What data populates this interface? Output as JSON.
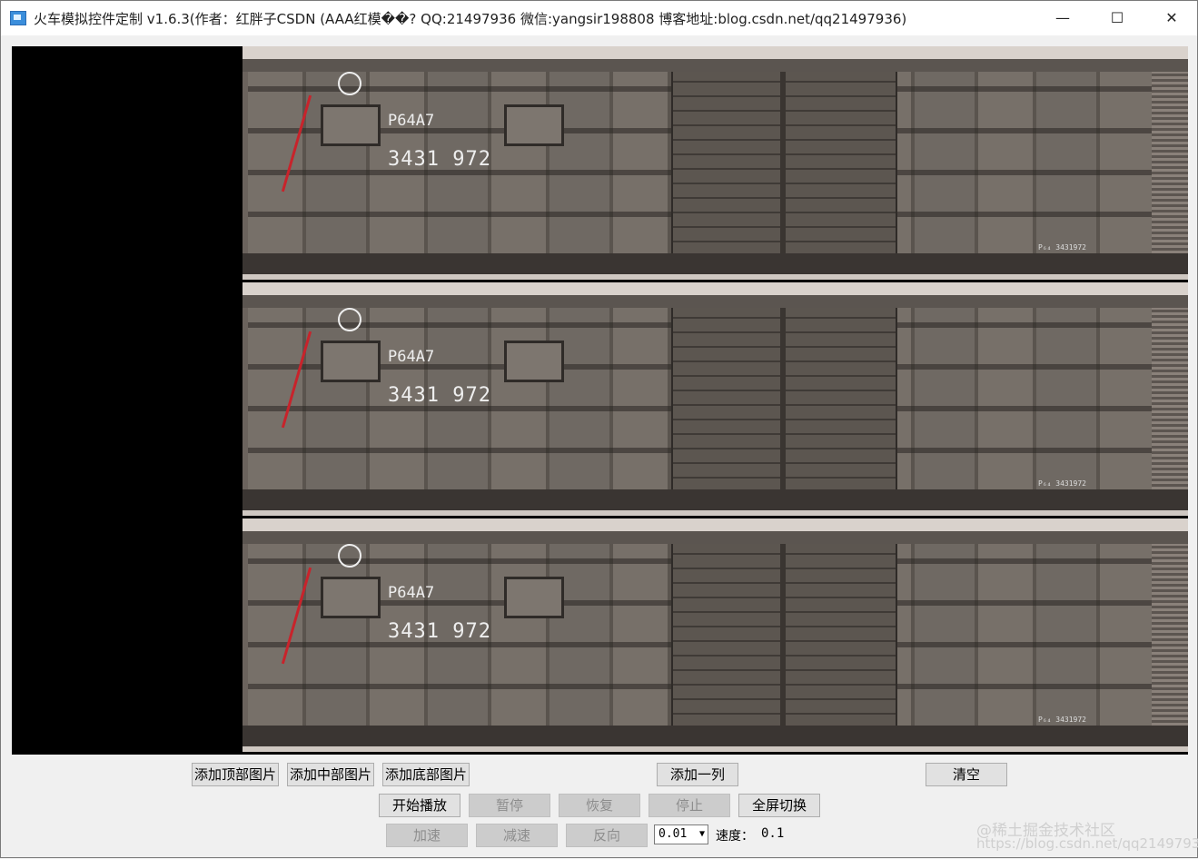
{
  "window": {
    "title": "火车模拟控件定制 v1.6.3(作者：红胖子CSDN (AAA红模��? QQ:21497936 微信:yangsir198808 博客地址:blog.csdn.net/qq21497936)",
    "minimize_glyph": "—",
    "maximize_glyph": "☐",
    "close_glyph": "✕"
  },
  "train": {
    "cars": [
      {
        "model": "P64A7",
        "number": "3431 972",
        "small": "P₆₄ 3431972"
      },
      {
        "model": "P64A7",
        "number": "3431 972",
        "small": "P₆₄ 3431972"
      },
      {
        "model": "P64A7",
        "number": "3431 972",
        "small": "P₆₄ 3431972"
      }
    ]
  },
  "controls": {
    "add_top": "添加顶部图片",
    "add_middle": "添加中部图片",
    "add_bottom": "添加底部图片",
    "add_column": "添加一列",
    "clear": "清空",
    "start": "开始播放",
    "pause": "暂停",
    "resume": "恢复",
    "stop": "停止",
    "fullscreen": "全屏切换",
    "accelerate": "加速",
    "decelerate": "减速",
    "reverse": "反向",
    "step_value": "0.01",
    "speed_label": "速度：",
    "speed_value": "0.1"
  },
  "watermark": {
    "brand": "@稀土掘金技术社区",
    "url": "https://blog.csdn.net/qq21497936"
  }
}
